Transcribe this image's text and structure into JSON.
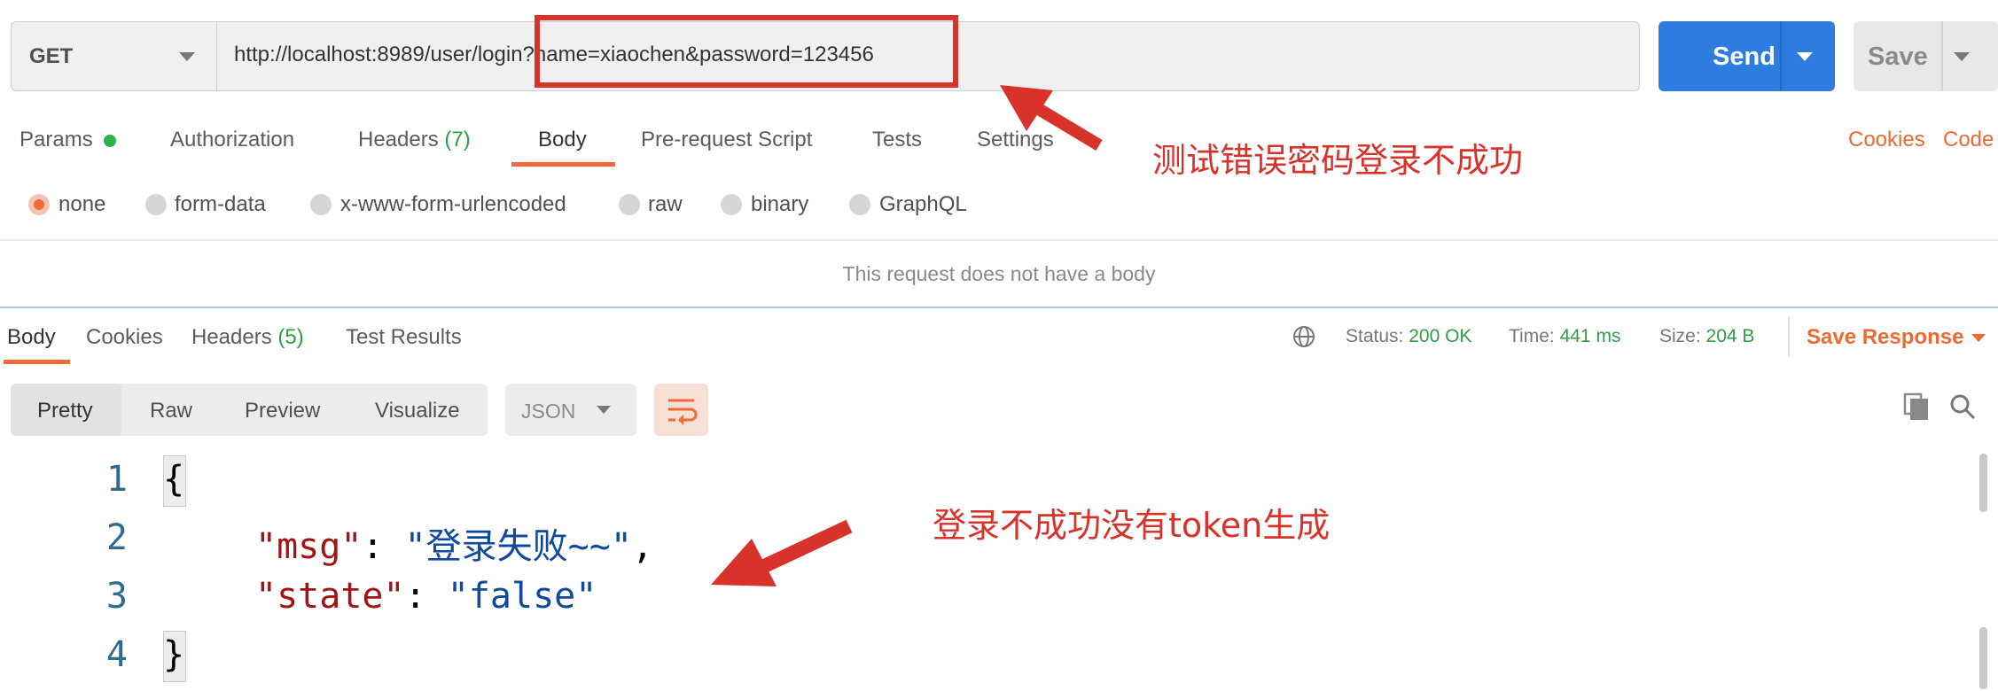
{
  "request": {
    "method": "GET",
    "url": "http://localhost:8989/user/login?name=xiaochen&password=123456",
    "send_label": "Send",
    "save_label": "Save"
  },
  "request_tabs": {
    "params": "Params",
    "authorization": "Authorization",
    "headers": "Headers",
    "headers_count": "(7)",
    "body": "Body",
    "pre_request": "Pre-request Script",
    "tests": "Tests",
    "settings": "Settings",
    "cookies": "Cookies",
    "code": "Code"
  },
  "body_types": [
    "none",
    "form-data",
    "x-www-form-urlencoded",
    "raw",
    "binary",
    "GraphQL"
  ],
  "body_empty_message": "This request does not have a body",
  "response_tabs": {
    "body": "Body",
    "cookies": "Cookies",
    "headers": "Headers",
    "headers_count": "(5)",
    "test_results": "Test Results"
  },
  "response_meta": {
    "status_label": "Status:",
    "status_value": "200 OK",
    "time_label": "Time:",
    "time_value": "441 ms",
    "size_label": "Size:",
    "size_value": "204 B",
    "save_response": "Save Response"
  },
  "view_modes": [
    "Pretty",
    "Raw",
    "Preview",
    "Visualize"
  ],
  "format": "JSON",
  "response_body": {
    "line_numbers": [
      "1",
      "2",
      "3",
      "4"
    ],
    "open_brace": "{",
    "close_brace": "}",
    "lines": [
      {
        "key": "\"msg\"",
        "sep": ": ",
        "value": "\"登录失败~~\"",
        "trail": ","
      },
      {
        "key": "\"state\"",
        "sep": ": ",
        "value": "\"false\"",
        "trail": ""
      }
    ]
  },
  "annotations": {
    "top_note": "测试错误密码登录不成功",
    "bottom_note": "登录不成功没有token生成"
  },
  "colors": {
    "accent": "#ef6a36",
    "send": "#2d7de0",
    "annotation": "#d8332a",
    "success": "#2f9e44"
  }
}
